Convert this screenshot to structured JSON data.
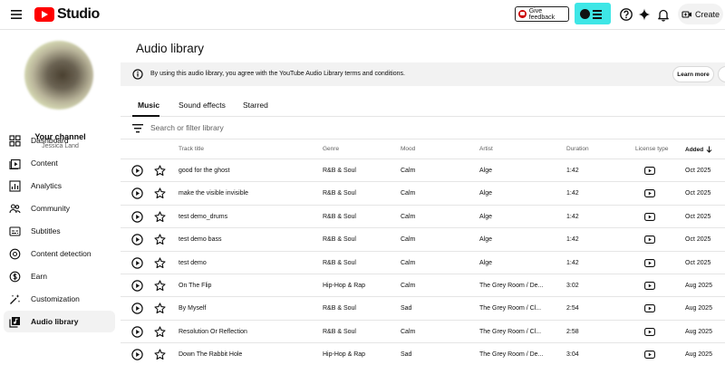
{
  "topbar": {
    "logo_text": "Studio",
    "feedback_label": "Give feedback",
    "create_label": "Create"
  },
  "sidebar": {
    "channel_title": "Your channel",
    "channel_user": "Jessica Land",
    "items": [
      {
        "label": "Dashboard",
        "icon": "dashboard-icon"
      },
      {
        "label": "Content",
        "icon": "content-icon"
      },
      {
        "label": "Analytics",
        "icon": "analytics-icon"
      },
      {
        "label": "Community",
        "icon": "community-icon"
      },
      {
        "label": "Subtitles",
        "icon": "subtitles-icon"
      },
      {
        "label": "Content detection",
        "icon": "content-detection-icon"
      },
      {
        "label": "Earn",
        "icon": "earn-icon"
      },
      {
        "label": "Customization",
        "icon": "customization-icon"
      },
      {
        "label": "Audio library",
        "icon": "audio-library-icon",
        "active": true
      }
    ]
  },
  "main": {
    "title": "Audio library",
    "notice": {
      "text": "By using this audio library, you agree with the YouTube Audio Library terms and conditions.",
      "learn_more": "Learn more"
    },
    "tabs": [
      "Music",
      "Sound effects",
      "Starred"
    ],
    "active_tab": "Music",
    "filter_placeholder": "Search or filter library",
    "columns": {
      "track": "Track title",
      "genre": "Genre",
      "mood": "Mood",
      "artist": "Artist",
      "duration": "Duration",
      "license": "License type",
      "added": "Added"
    },
    "rows": [
      {
        "title": "good for the ghost",
        "genre": "R&B & Soul",
        "mood": "Calm",
        "artist": "Alge",
        "duration": "1:42",
        "added": "Oct 2025"
      },
      {
        "title": "make the visible invisible",
        "genre": "R&B & Soul",
        "mood": "Calm",
        "artist": "Alge",
        "duration": "1:42",
        "added": "Oct 2025"
      },
      {
        "title": "test demo_drums",
        "genre": "R&B & Soul",
        "mood": "Calm",
        "artist": "Alge",
        "duration": "1:42",
        "added": "Oct 2025"
      },
      {
        "title": "test demo bass",
        "genre": "R&B & Soul",
        "mood": "Calm",
        "artist": "Alge",
        "duration": "1:42",
        "added": "Oct 2025"
      },
      {
        "title": "test demo",
        "genre": "R&B & Soul",
        "mood": "Calm",
        "artist": "Alge",
        "duration": "1:42",
        "added": "Oct 2025"
      },
      {
        "title": "On The Flip",
        "genre": "Hip-Hop & Rap",
        "mood": "Calm",
        "artist": "The Grey Room / De...",
        "duration": "3:02",
        "added": "Aug 2025"
      },
      {
        "title": "By Myself",
        "genre": "R&B & Soul",
        "mood": "Sad",
        "artist": "The Grey Room / Cl...",
        "duration": "2:54",
        "added": "Aug 2025"
      },
      {
        "title": "Resolution Or Reflection",
        "genre": "R&B & Soul",
        "mood": "Calm",
        "artist": "The Grey Room / Cl...",
        "duration": "2:58",
        "added": "Aug 2025"
      },
      {
        "title": "Down The Rabbit Hole",
        "genre": "Hip-Hop & Rap",
        "mood": "Sad",
        "artist": "The Grey Room / De...",
        "duration": "3:04",
        "added": "Aug 2025"
      }
    ]
  }
}
